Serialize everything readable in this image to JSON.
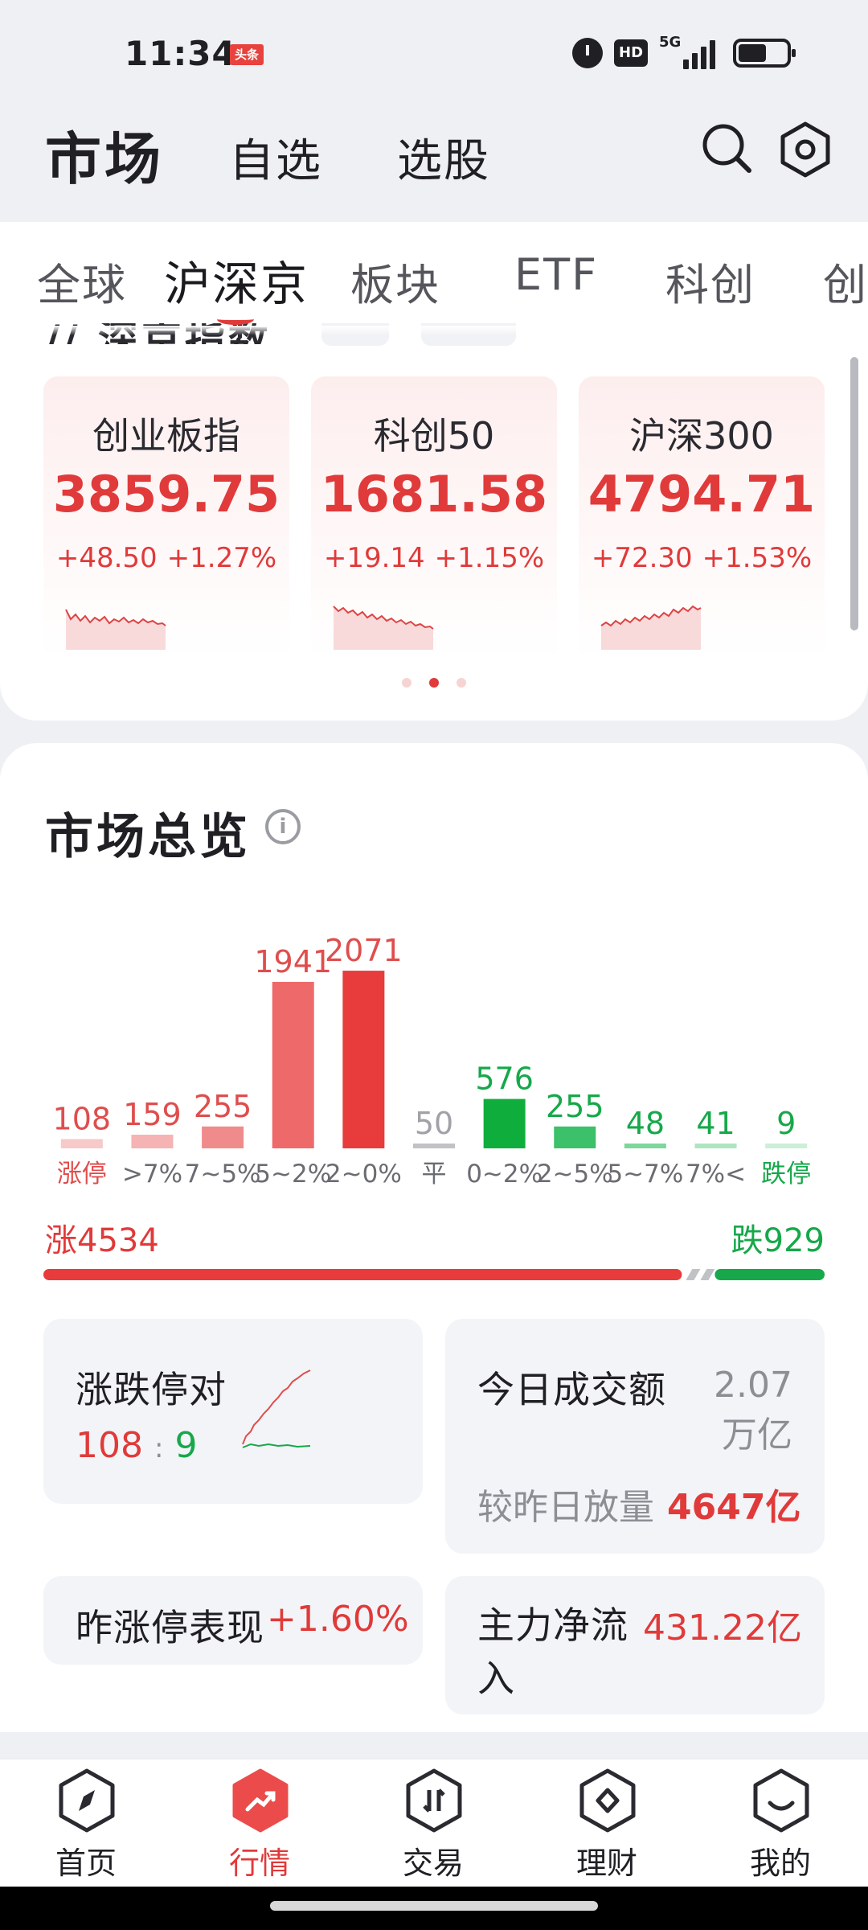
{
  "status_bar": {
    "time": "11:34",
    "app_badge": "头条",
    "hd": "HD",
    "network": "5G"
  },
  "header": {
    "title": "市场",
    "tabs": [
      "自选",
      "选股"
    ]
  },
  "market_tabs": {
    "items": [
      "全球",
      "沪深京",
      "板块",
      "ETF",
      "科创",
      "创"
    ],
    "active_index": 1
  },
  "section_peek": {
    "title": "// 深京指数"
  },
  "indices": [
    {
      "name": "创业板指",
      "value": "3859.75",
      "change": "+48.50",
      "change_pct": "+1.27%"
    },
    {
      "name": "科创50",
      "value": "1681.58",
      "change": "+19.14",
      "change_pct": "+1.15%"
    },
    {
      "name": "沪深300",
      "value": "4794.71",
      "change": "+72.30",
      "change_pct": "+1.53%"
    }
  ],
  "carousel": {
    "pages": 3,
    "active": 1
  },
  "overview": {
    "title": "市场总览",
    "info_icon": "i",
    "summary": {
      "up_label": "涨4534",
      "down_label": "跌929",
      "up": 4534,
      "flat": 50,
      "down": 929
    },
    "limit_pair": {
      "label": "涨跌停对",
      "up": "108",
      "sep": ":",
      "down": "9"
    },
    "turnover": {
      "label": "今日成交额",
      "value": "2.07万亿",
      "compare_label": "较昨日放量",
      "compare_value": "4647亿"
    },
    "yesterday_limit": {
      "label": "昨涨停表现",
      "value": "+1.60%"
    },
    "main_flow": {
      "label": "主力净流入",
      "value": "431.22亿"
    }
  },
  "chart_data": {
    "type": "bar",
    "categories": [
      "涨停",
      ">7%",
      "7~5%",
      "5~2%",
      "2~0%",
      "平",
      "0~2%",
      "2~5%",
      "5~7%",
      "7%<",
      "跌停"
    ],
    "values": [
      108,
      159,
      255,
      1941,
      2071,
      50,
      576,
      255,
      48,
      41,
      9
    ],
    "bar_colors": [
      "#f7c9c9",
      "#f5b3b3",
      "#f08b8b",
      "#ee6a6a",
      "#e83b3b",
      "#c0c2c6",
      "#0fae3c",
      "#3cc06a",
      "#7dd69b",
      "#aee5c0",
      "#cdeed8"
    ],
    "label_colors": [
      "#e04d4d",
      "#e04d4d",
      "#e04d4d",
      "#e04d4d",
      "#e04d4d",
      "#a0a2a8",
      "#16a84a",
      "#16a84a",
      "#16a84a",
      "#16a84a",
      "#16a84a"
    ],
    "category_colors": [
      "#e04d4d",
      "#6a6c72",
      "#6a6c72",
      "#6a6c72",
      "#6a6c72",
      "#6a6c72",
      "#6a6c72",
      "#6a6c72",
      "#6a6c72",
      "#6a6c72",
      "#16a84a"
    ],
    "ylim": [
      0,
      2100
    ],
    "title": "",
    "xlabel": "",
    "ylabel": ""
  },
  "bottom_nav": {
    "items": [
      "首页",
      "行情",
      "交易",
      "理财",
      "我的"
    ],
    "active_index": 1
  },
  "colors": {
    "up": "#e03a3a",
    "down": "#16a84a",
    "flat": "#c0c2c6"
  }
}
